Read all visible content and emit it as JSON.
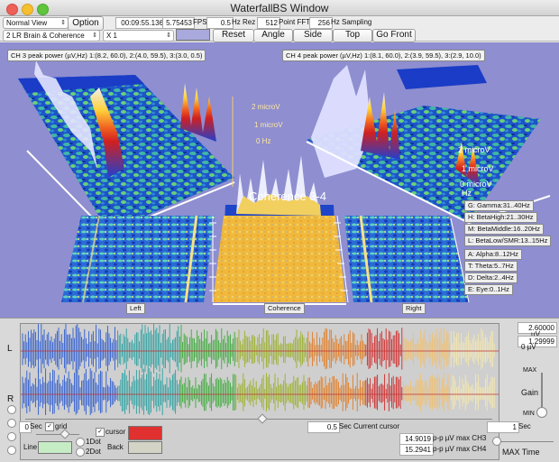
{
  "window": {
    "title": "WaterfallBS Window"
  },
  "toolbar": {
    "view_select": "Normal View",
    "option_button": "Option",
    "elapsed": "00:09:55.136",
    "fps_value": "5.75453",
    "fps_label": "FPS",
    "hz_rez_value": "0.5",
    "hz_rez_label": "Hz Rez",
    "fft_value": "512",
    "fft_label": "Point FFT",
    "sampling_value": "256",
    "sampling_label": "Hz Sampling",
    "montage_select": "2 LR Brain & Coherence",
    "scale_select": "X 1",
    "swatch_color": "#a9a9dd",
    "reset_button": "Reset",
    "angle_button": "Angle",
    "side_button": "Side",
    "top_button": "Top",
    "gofront_button": "Go Front"
  },
  "view3d": {
    "background": "#8e8ed0",
    "ch3_peak": "CH 3 peak power (µV,Hz) 1:(8.2, 60.0), 2:(4.0, 59.5), 3:(3.0, 0.5)",
    "ch4_peak": "CH 4 peak power (µV,Hz) 1:(8.1, 60.0), 2:(3.9, 59.5), 3:(2.9, 10.0)",
    "coherence_label": "Coherence 3-4",
    "left_axis": {
      "labels": [
        "2 microV",
        "1 microV",
        "0 Hz",
        "0 microV"
      ]
    },
    "right_axis": {
      "labels": [
        "2 microV",
        "1 microV",
        "0 microV",
        "Hz"
      ]
    },
    "plane_left": "Left",
    "plane_coherence": "Coherence",
    "plane_right": "Right",
    "bands": [
      "G: Gamma:31..40Hz",
      "H: BetaHigh:21..30Hz",
      "M: BetaMiddle:16..20Hz",
      "L: BetaLow/SMR:13..15Hz",
      "A: Alpha:8..12Hz",
      "T: Theta:5..7Hz",
      "D: Delta:2..4Hz",
      "E: Eye:0..1Hz"
    ]
  },
  "wave": {
    "axis_L": "L",
    "axis_R": "R",
    "max_uv": "2.60000",
    "uv_label": "µV",
    "uv_value": "1.29999",
    "zero_uv": "0 µV",
    "max_label": "MAX",
    "gain_label": "Gain",
    "min_label": "MIN",
    "sec_value": "0",
    "sec_label": "Sec",
    "grid_label": "grid",
    "cursor_label": "cursor",
    "line_label": "Line",
    "dot1_label": "1Dot",
    "dot2_label": "2Dot",
    "back_label": "Back",
    "cursor_sec": "0.5",
    "current_cursor": "Sec Current cursor",
    "ch3_value": "14.9019",
    "ch3_label": "p-p µV max CH3",
    "ch4_value": "15.2941",
    "ch4_label": "p-p µV max CH4",
    "max_sec": "1",
    "max_sec_label": "Sec",
    "max_time_label": "MAX Time",
    "cursor_color": "#e03030",
    "line_color": "#c6ecc6",
    "back_color": "#d4d4c6"
  }
}
